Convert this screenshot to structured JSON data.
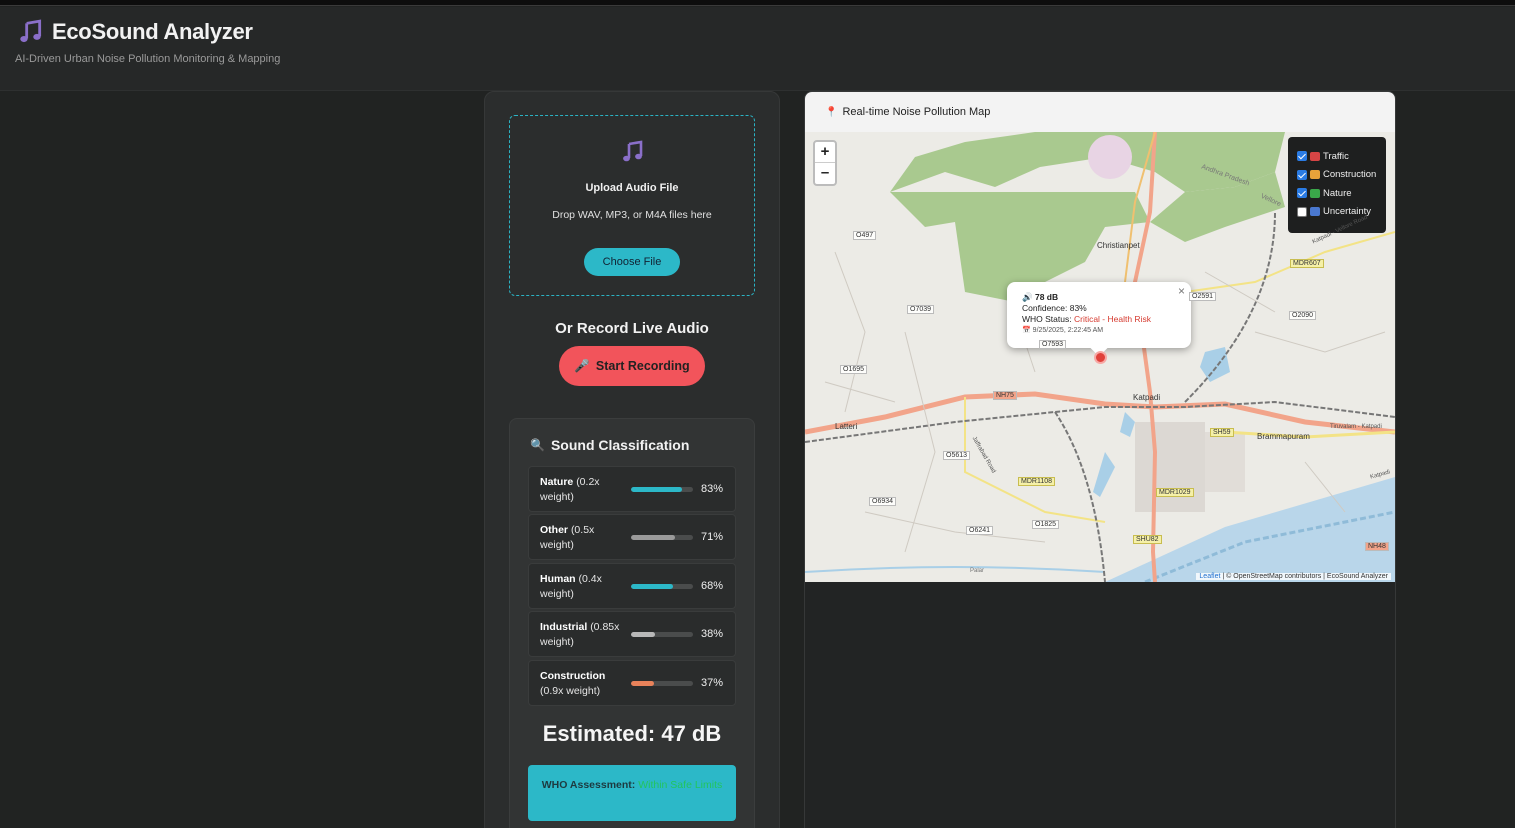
{
  "header": {
    "title": "EcoSound Analyzer",
    "subtitle": "AI-Driven Urban Noise Pollution Monitoring & Mapping",
    "icon": "music-note-icon"
  },
  "upload": {
    "title": "Upload Audio File",
    "subtitle": "Drop WAV, MP3, or M4A files here",
    "button": "Choose File"
  },
  "record": {
    "title": "Or Record Live Audio",
    "button": "Start Recording",
    "button_icon": "🎤"
  },
  "classification": {
    "title": "Sound Classification",
    "icon": "🔍",
    "items": [
      {
        "name": "Nature",
        "weight": "(0.2x weight)",
        "percent": "83%",
        "value": 0.83,
        "color": "#2cb8c8"
      },
      {
        "name": "Other",
        "weight": "(0.5x weight)",
        "percent": "71%",
        "value": 0.71,
        "color": "#9a9a9a"
      },
      {
        "name": "Human",
        "weight": "(0.4x weight)",
        "percent": "68%",
        "value": 0.68,
        "color": "#2cb8c8"
      },
      {
        "name": "Industrial",
        "weight": "(0.85x weight)",
        "percent": "38%",
        "value": 0.38,
        "color": "#b8b8b8"
      },
      {
        "name": "Construction",
        "weight": "(0.9x weight)",
        "percent": "37%",
        "value": 0.37,
        "color": "#e8825a"
      }
    ],
    "estimated": "Estimated: 47 dB",
    "who_label": "WHO Assessment:",
    "who_value": "Within Safe Limits"
  },
  "map": {
    "title": "Real-time Noise Pollution Map",
    "title_icon": "📍",
    "zoom_in": "+",
    "zoom_out": "–",
    "layers": [
      {
        "label": "Traffic",
        "checked": true,
        "color": "#d64545"
      },
      {
        "label": "Construction",
        "checked": true,
        "color": "#e8a23a"
      },
      {
        "label": "Nature",
        "checked": true,
        "color": "#3aa84a"
      },
      {
        "label": "Uncertainty",
        "checked": false,
        "color": "#4a78d0"
      }
    ],
    "popup": {
      "level": "78 dB",
      "confidence": "Confidence: 83%",
      "who_label": "WHO Status:",
      "who_value": "Critical - Health Risk",
      "timestamp": "9/25/2025, 2:22:45 AM",
      "close": "×"
    },
    "place_labels": [
      "Christianpet",
      "Katpadi",
      "Latteri",
      "Brammapuram",
      "Andhra Pradesh",
      "Vellore",
      "Katpadi - Vellore Road",
      "Tiruvalam - Katpadi",
      "Jaffrabad Road",
      "Palar",
      "Katpadi"
    ],
    "road_shields": [
      "O497",
      "O7039",
      "O1695",
      "O5613",
      "O6934",
      "O6241",
      "O1825",
      "MDR607",
      "O2090",
      "O2591",
      "NH75",
      "SH59",
      "MDR1108",
      "MDR1029",
      "SHU82",
      "NH48",
      "O7593"
    ],
    "attribution_link": "Leaflet",
    "attribution_text": "| © OpenStreetMap contributors | EcoSound Analyzer"
  }
}
